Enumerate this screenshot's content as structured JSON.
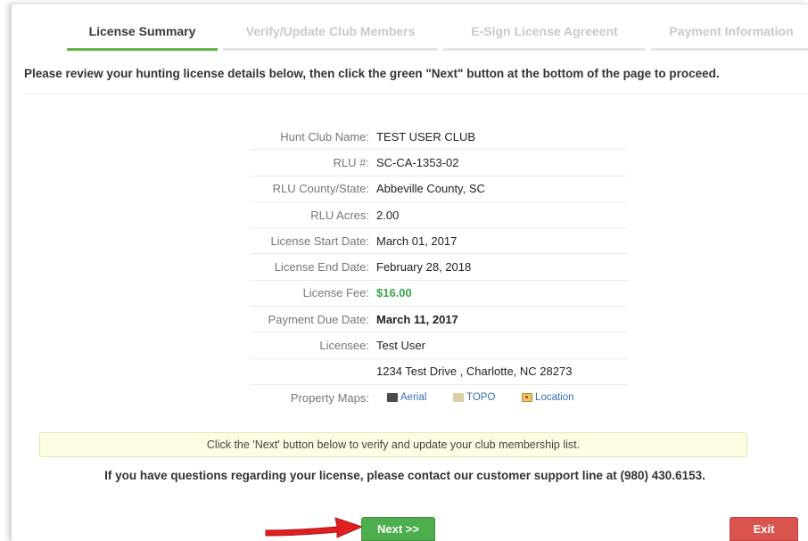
{
  "tabs": [
    {
      "label": "License Summary",
      "active": true
    },
    {
      "label": "Verify/Update Club Members",
      "active": false
    },
    {
      "label": "E-Sign License Agreeent",
      "active": false
    },
    {
      "label": "Payment Information",
      "active": false
    }
  ],
  "intro_text": "Please review your hunting license details below, then click the green \"Next\" button at the bottom of the page to proceed.",
  "details": {
    "hunt_club_name": {
      "label": "Hunt Club Name:",
      "value": "TEST USER CLUB"
    },
    "rlu_number": {
      "label": "RLU #:",
      "value": "SC-CA-1353-02"
    },
    "rlu_county_state": {
      "label": "RLU County/State:",
      "value": "Abbeville County, SC"
    },
    "rlu_acres": {
      "label": "RLU Acres:",
      "value": "2.00"
    },
    "license_start_date": {
      "label": "License Start Date:",
      "value": "March 01, 2017"
    },
    "license_end_date": {
      "label": "License End Date:",
      "value": "February 28, 2018"
    },
    "license_fee": {
      "label": "License Fee:",
      "value": "$16.00"
    },
    "payment_due_date": {
      "label": "Payment Due Date:",
      "value": "March 11, 2017"
    },
    "licensee": {
      "label": "Licensee:",
      "value": "Test User"
    },
    "address": {
      "label": "",
      "value": "1234 Test Drive , Charlotte, NC 28273"
    },
    "property_maps": {
      "label": "Property Maps:",
      "links": [
        {
          "label": "Aerial",
          "icon": "aerial-map-icon"
        },
        {
          "label": "TOPO",
          "icon": "topo-map-icon"
        },
        {
          "label": "Location",
          "icon": "location-map-icon"
        }
      ]
    }
  },
  "notice_text": "Click the 'Next' button below to verify and update your club membership list.",
  "support_text": "If you have questions regarding your license, please contact our customer support line at (980) 430.6153.",
  "buttons": {
    "next_label": "Next >>",
    "exit_label": "Exit"
  },
  "colors": {
    "active_tab_underline": "#5fb646",
    "fee_green": "#3aa54a",
    "next_green": "#4cae4c",
    "exit_red": "#d9534f",
    "arrow_red": "#e02020",
    "notice_bg": "#fdfde3"
  }
}
